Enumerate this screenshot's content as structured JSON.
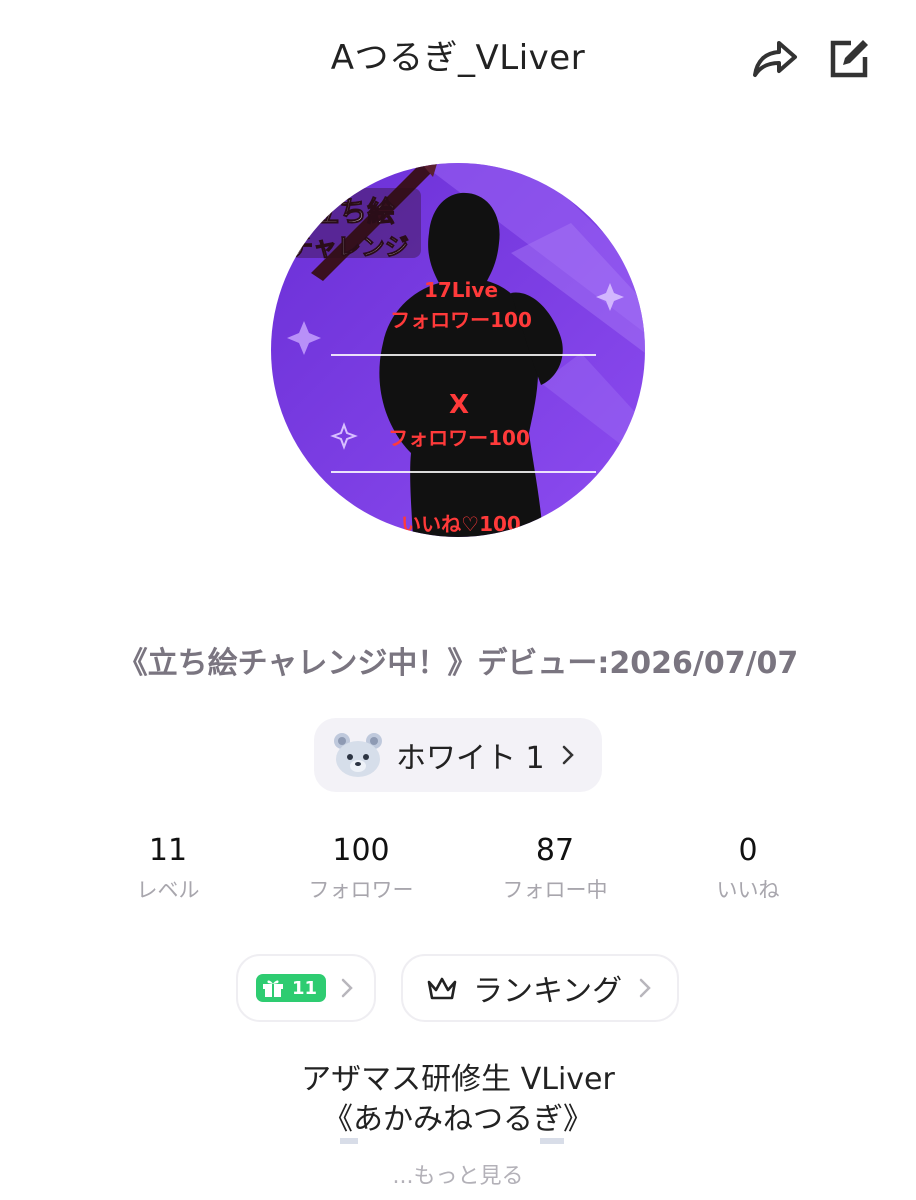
{
  "header": {
    "title": "Aつるぎ_VLiver",
    "share_icon": "share-icon",
    "edit_icon": "edit-icon"
  },
  "avatar": {
    "badge_text": [
      "立ち絵",
      "チャレンジ"
    ],
    "lines": [
      {
        "text": "17Live"
      },
      {
        "text": "フォロワー100"
      },
      {
        "text": "X"
      },
      {
        "text": "フォロワー100"
      },
      {
        "text": "いいね♡100"
      }
    ],
    "colors": {
      "background": "#7b3fe0",
      "text": "#ff3a3a"
    }
  },
  "bio_line": "《立ち絵チャレンジ中！》デビュー:2026/07/07",
  "tier": {
    "label": "ホワイト 1",
    "icon": "bear-icon"
  },
  "stats": [
    {
      "value": "11",
      "label": "レベル"
    },
    {
      "value": "100",
      "label": "フォロワー"
    },
    {
      "value": "87",
      "label": "フォロー中"
    },
    {
      "value": "0",
      "label": "いいね"
    }
  ],
  "gift": {
    "count": "11",
    "icon": "gift-icon",
    "color": "#2ecc71"
  },
  "ranking": {
    "label": "ランキング",
    "icon": "crown-icon"
  },
  "bio": {
    "line1": "アザマス研修生 VLiver",
    "line2": "《あかみねつるぎ》"
  },
  "more_label": "...もっと見る"
}
